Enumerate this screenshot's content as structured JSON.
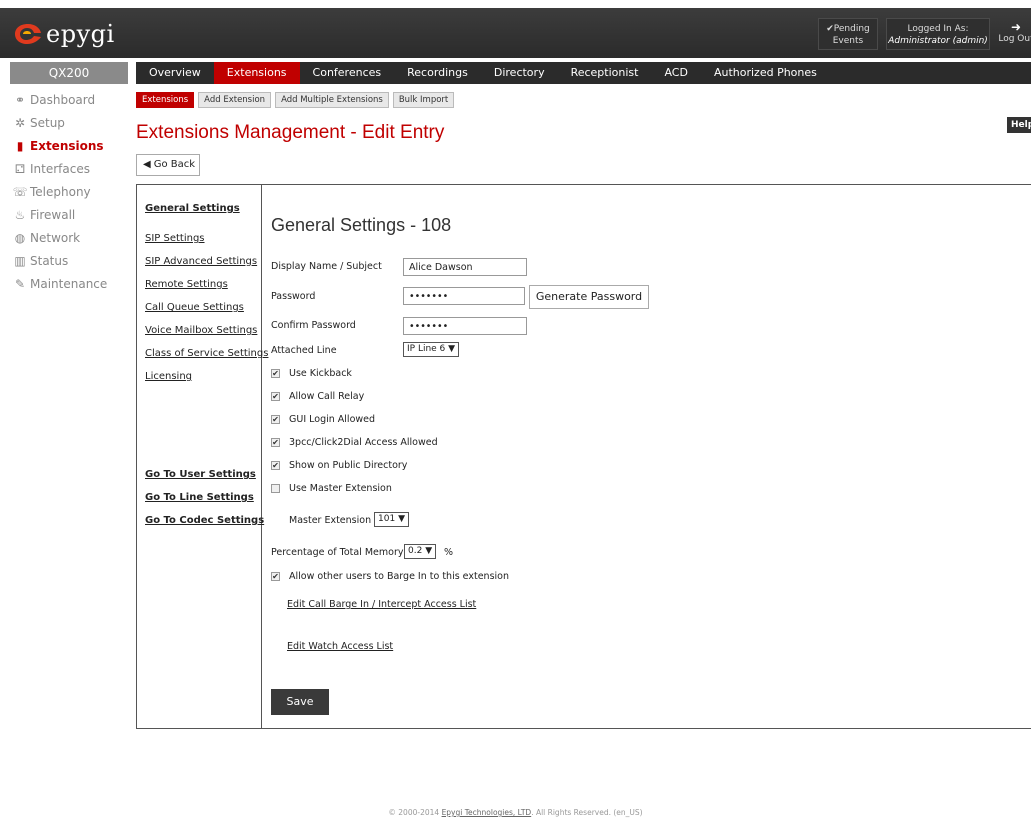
{
  "brand": {
    "name": "epygi",
    "accent": "#c00000"
  },
  "header": {
    "pending_line1": "✔Pending",
    "pending_line2": "Events",
    "login_line1": "Logged In As:",
    "login_user": "Administrator (admin)",
    "logout_label": "Log Out",
    "logout_icon": "logout-icon"
  },
  "sidebar": {
    "model": "QX200",
    "items": [
      {
        "label": "Dashboard",
        "icon": "dashboard-icon",
        "glyph": "⚭"
      },
      {
        "label": "Setup",
        "icon": "gear-icon",
        "glyph": "✲"
      },
      {
        "label": "Extensions",
        "icon": "book-icon",
        "glyph": "▮"
      },
      {
        "label": "Interfaces",
        "icon": "network-tree-icon",
        "glyph": "⚁"
      },
      {
        "label": "Telephony",
        "icon": "phone-icon",
        "glyph": "☏"
      },
      {
        "label": "Firewall",
        "icon": "flame-icon",
        "glyph": "♨"
      },
      {
        "label": "Network",
        "icon": "globe-icon",
        "glyph": "◍"
      },
      {
        "label": "Status",
        "icon": "bar-chart-icon",
        "glyph": "▥"
      },
      {
        "label": "Maintenance",
        "icon": "wrench-icon",
        "glyph": "✎"
      }
    ]
  },
  "topnav": [
    "Overview",
    "Extensions",
    "Conferences",
    "Recordings",
    "Directory",
    "Receptionist",
    "ACD",
    "Authorized Phones"
  ],
  "subnav": [
    "Extensions",
    "Add Extension",
    "Add Multiple Extensions",
    "Bulk Import"
  ],
  "page": {
    "title": "Extensions Management - Edit Entry",
    "help": "Help",
    "go_back": "Go Back"
  },
  "left_links": [
    "General Settings",
    "SIP Settings",
    "SIP Advanced Settings",
    "Remote Settings",
    "Call Queue Settings",
    "Voice Mailbox Settings",
    "Class of Service Settings",
    "Licensing"
  ],
  "bottom_links": [
    "Go To User Settings",
    "Go To Line Settings",
    "Go To Codec Settings"
  ],
  "form": {
    "title": "General Settings - 108",
    "display_name_label": "Display Name / Subject",
    "display_name_value": "Alice Dawson",
    "password_label": "Password",
    "password_value": "•••••••",
    "generate_password": "Generate Password",
    "confirm_password_label": "Confirm Password",
    "confirm_password_value": "•••••••",
    "attached_line_label": "Attached Line",
    "attached_line_value": "IP Line 6",
    "checkboxes": [
      {
        "label": "Use Kickback",
        "checked": true
      },
      {
        "label": "Allow Call Relay",
        "checked": true
      },
      {
        "label": "GUI Login Allowed",
        "checked": true
      },
      {
        "label": "3pcc/Click2Dial Access Allowed",
        "checked": true
      },
      {
        "label": "Show on Public Directory",
        "checked": true
      },
      {
        "label": "Use Master Extension",
        "checked": false
      }
    ],
    "master_extension_label": "Master Extension",
    "master_extension_value": "101",
    "memory_label": "Percentage of Total Memory",
    "memory_value": "0.2",
    "memory_unit": "%",
    "barge_label": "Allow other users to Barge In to this extension",
    "barge_checked": true,
    "edit_barge_link": "Edit Call Barge In / Intercept Access List",
    "edit_watch_link": "Edit Watch Access List",
    "save": "Save"
  },
  "footer": {
    "prefix": "© 2000-2014",
    "company": "Epygi Technologies, LTD",
    "suffix": ". All Rights Reserved. (en_US)"
  }
}
